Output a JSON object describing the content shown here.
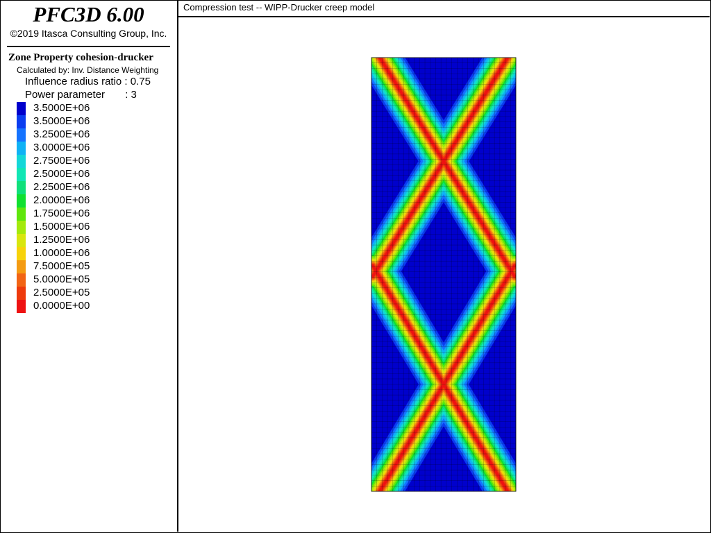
{
  "header": {
    "app_title": "PFC3D 6.00",
    "copyright": "©2019 Itasca Consulting Group, Inc."
  },
  "legend": {
    "title": "Zone Property cohesion-drucker",
    "method": "Calculated by: Inv. Distance Weighting",
    "influence_label": "Influence radius ratio : 0.75",
    "power_label": "Power parameter       : 3",
    "entries": [
      {
        "label": "3.5000E+06",
        "color": "#0000cc"
      },
      {
        "label": "3.5000E+06",
        "color": "#0b3df0"
      },
      {
        "label": "3.2500E+06",
        "color": "#1573ff"
      },
      {
        "label": "3.0000E+06",
        "color": "#0fb2f5"
      },
      {
        "label": "2.7500E+06",
        "color": "#13d7d8"
      },
      {
        "label": "2.5000E+06",
        "color": "#10e6b4"
      },
      {
        "label": "2.2500E+06",
        "color": "#0fe07b"
      },
      {
        "label": "2.0000E+06",
        "color": "#10e030"
      },
      {
        "label": "1.7500E+06",
        "color": "#5fe60c"
      },
      {
        "label": "1.5000E+06",
        "color": "#a3ea0c"
      },
      {
        "label": "1.2500E+06",
        "color": "#d8e60e"
      },
      {
        "label": "1.0000E+06",
        "color": "#f7d20a"
      },
      {
        "label": "7.5000E+05",
        "color": "#f49b12"
      },
      {
        "label": "5.0000E+05",
        "color": "#f26414"
      },
      {
        "label": "2.5000E+05",
        "color": "#ee3a0c"
      },
      {
        "label": "0.0000E+00",
        "color": "#ee1212"
      }
    ]
  },
  "plot": {
    "title": "Compression test -- WIPP-Drucker creep model",
    "grid_color": "#000000",
    "grid_columns": 27,
    "grid_rows": 81
  }
}
